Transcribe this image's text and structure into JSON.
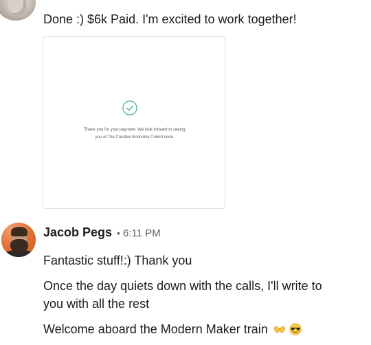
{
  "previous_message": {
    "text": "Done :) $6k Paid. I'm excited to work together!",
    "attachment": {
      "line1": "Thank you for your payment. We look forward to seeing",
      "line2": "you at The Creative Economy Cohort soon.",
      "icon": "check-circle-icon",
      "icon_color": "#3fae7a"
    }
  },
  "message": {
    "author": "Jacob Pegs",
    "separator": "•",
    "time": "6:11 PM",
    "avatar_color": "#e0703a",
    "lines": [
      "Fantastic stuff!:) Thank you",
      "Once the day quiets down with the calls, I'll write to",
      "you with all the rest",
      "Welcome aboard the Modern Maker train"
    ],
    "emojis": [
      "heart-hands-emoji",
      "sunglasses-face-emoji"
    ]
  }
}
